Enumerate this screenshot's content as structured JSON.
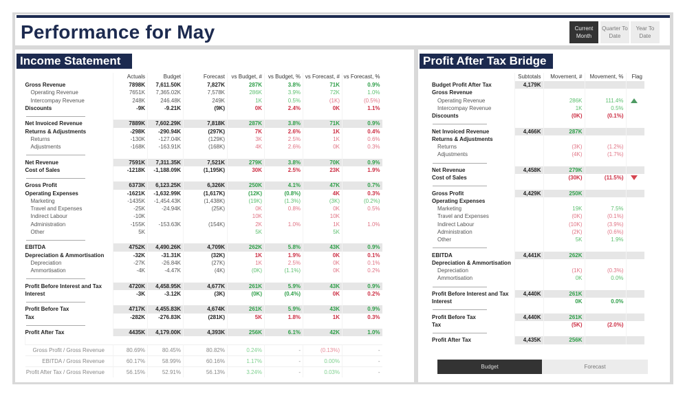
{
  "header": {
    "title": "Performance for May",
    "periods": [
      {
        "label": "Current Month",
        "active": true
      },
      {
        "label": "Quarter To Date",
        "active": false
      },
      {
        "label": "Year To Date",
        "active": false
      }
    ]
  },
  "colors": {
    "navy": "#1c2a4f",
    "positive": "#2e9e48",
    "negative": "#cc2f44"
  },
  "income": {
    "title": "Income Statement",
    "columns": [
      "",
      "Actuals",
      "Budget",
      "Forecast",
      "vs Budget, #",
      "vs Budget, %",
      "vs Forecast, #",
      "vs Forecast, %"
    ],
    "rows": [
      {
        "label": "Gross Revenue",
        "type": "bold",
        "cells": [
          "7898K",
          "7,611.50K",
          "7,827K",
          "287K",
          "3.8%",
          "71K",
          "0.9%"
        ],
        "tones": [
          "",
          "",
          "",
          "g",
          "g",
          "g",
          "g"
        ]
      },
      {
        "label": "Operating Revenue",
        "type": "sub",
        "cells": [
          "7651K",
          "7,365.02K",
          "7,578K",
          "286K",
          "3.9%",
          "72K",
          "1.0%"
        ],
        "tones": [
          "",
          "",
          "",
          "g",
          "g",
          "g",
          "g"
        ]
      },
      {
        "label": "Intercompay Revenue",
        "type": "sub",
        "cells": [
          "248K",
          "246.48K",
          "249K",
          "1K",
          "0.5%",
          "(1K)",
          "(0.5%)"
        ],
        "tones": [
          "",
          "",
          "",
          "g",
          "g",
          "r",
          "r"
        ]
      },
      {
        "label": "Discounts",
        "type": "bold",
        "cells": [
          "-9K",
          "-9.21K",
          "(9K)",
          "0K",
          "2.4%",
          "0K",
          "1.1%"
        ],
        "tones": [
          "",
          "",
          "",
          "r",
          "r",
          "r",
          "r"
        ]
      },
      {
        "type": "sep"
      },
      {
        "label": "Net Invoiced Revenue",
        "type": "total",
        "cells": [
          "7889K",
          "7,602.29K",
          "7,818K",
          "287K",
          "3.8%",
          "71K",
          "0.9%"
        ],
        "tones": [
          "",
          "",
          "",
          "g",
          "g",
          "g",
          "g"
        ]
      },
      {
        "label": "Returns & Adjustments",
        "type": "bold",
        "cells": [
          "-298K",
          "-290.94K",
          "(297K)",
          "7K",
          "2.6%",
          "1K",
          "0.4%"
        ],
        "tones": [
          "",
          "",
          "",
          "r",
          "r",
          "r",
          "r"
        ]
      },
      {
        "label": "Returns",
        "type": "sub",
        "cells": [
          "-130K",
          "-127.04K",
          "(129K)",
          "3K",
          "2.5%",
          "1K",
          "0.6%"
        ],
        "tones": [
          "",
          "",
          "",
          "r",
          "r",
          "r",
          "r"
        ]
      },
      {
        "label": "Adjustments",
        "type": "sub",
        "cells": [
          "-168K",
          "-163.91K",
          "(168K)",
          "4K",
          "2.6%",
          "0K",
          "0.3%"
        ],
        "tones": [
          "",
          "",
          "",
          "r",
          "r",
          "r",
          "r"
        ]
      },
      {
        "type": "sep"
      },
      {
        "label": "Net Revenue",
        "type": "total",
        "cells": [
          "7591K",
          "7,311.35K",
          "7,521K",
          "279K",
          "3.8%",
          "70K",
          "0.9%"
        ],
        "tones": [
          "",
          "",
          "",
          "g",
          "g",
          "g",
          "g"
        ]
      },
      {
        "label": "Cost of Sales",
        "type": "bold",
        "cells": [
          "-1218K",
          "-1,188.09K",
          "(1,195K)",
          "30K",
          "2.5%",
          "23K",
          "1.9%"
        ],
        "tones": [
          "",
          "",
          "",
          "r",
          "r",
          "r",
          "r"
        ]
      },
      {
        "type": "sep"
      },
      {
        "label": "Gross Profit",
        "type": "total",
        "cells": [
          "6373K",
          "6,123.25K",
          "6,326K",
          "250K",
          "4.1%",
          "47K",
          "0.7%"
        ],
        "tones": [
          "",
          "",
          "",
          "g",
          "g",
          "g",
          "g"
        ]
      },
      {
        "label": "Operating Expenses",
        "type": "bold",
        "cells": [
          "-1621K",
          "-1,632.99K",
          "(1,617K)",
          "(12K)",
          "(0.8%)",
          "4K",
          "0.3%"
        ],
        "tones": [
          "",
          "",
          "",
          "g",
          "g",
          "r",
          "r"
        ]
      },
      {
        "label": "Marketing",
        "type": "sub",
        "cells": [
          "-1435K",
          "-1,454.43K",
          "(1,438K)",
          "(19K)",
          "(1.3%)",
          "(3K)",
          "(0.2%)"
        ],
        "tones": [
          "",
          "",
          "",
          "g",
          "g",
          "g",
          "g"
        ]
      },
      {
        "label": "Travel and Expenses",
        "type": "sub",
        "cells": [
          "-25K",
          "-24.94K",
          "(25K)",
          "0K",
          "0.8%",
          "0K",
          "0.5%"
        ],
        "tones": [
          "",
          "",
          "",
          "r",
          "r",
          "r",
          "r"
        ]
      },
      {
        "label": "Indirect Labour",
        "type": "sub",
        "cells": [
          "-10K",
          "",
          "",
          "10K",
          "",
          "10K",
          ""
        ],
        "tones": [
          "",
          "",
          "",
          "r",
          "",
          "r",
          ""
        ]
      },
      {
        "label": "Administration",
        "type": "sub",
        "cells": [
          "-155K",
          "-153.63K",
          "(154K)",
          "2K",
          "1.0%",
          "1K",
          "1.0%"
        ],
        "tones": [
          "",
          "",
          "",
          "r",
          "r",
          "r",
          "r"
        ]
      },
      {
        "label": "Other",
        "type": "sub",
        "cells": [
          "5K",
          "",
          "",
          "5K",
          "",
          "5K",
          ""
        ],
        "tones": [
          "",
          "",
          "",
          "g",
          "",
          "g",
          ""
        ]
      },
      {
        "type": "sep"
      },
      {
        "label": "EBITDA",
        "type": "total",
        "cells": [
          "4752K",
          "4,490.26K",
          "4,709K",
          "262K",
          "5.8%",
          "43K",
          "0.9%"
        ],
        "tones": [
          "",
          "",
          "",
          "g",
          "g",
          "g",
          "g"
        ]
      },
      {
        "label": "Depreciation & Ammortisation",
        "type": "bold",
        "cells": [
          "-32K",
          "-31.31K",
          "(32K)",
          "1K",
          "1.9%",
          "0K",
          "0.1%"
        ],
        "tones": [
          "",
          "",
          "",
          "r",
          "r",
          "r",
          "r"
        ]
      },
      {
        "label": "Depreciation",
        "type": "sub",
        "cells": [
          "-27K",
          "-26.84K",
          "(27K)",
          "1K",
          "2.5%",
          "0K",
          "0.1%"
        ],
        "tones": [
          "",
          "",
          "",
          "r",
          "r",
          "r",
          "r"
        ]
      },
      {
        "label": "Ammortisation",
        "type": "sub",
        "cells": [
          "-4K",
          "-4.47K",
          "(4K)",
          "(0K)",
          "(1.1%)",
          "0K",
          "0.2%"
        ],
        "tones": [
          "",
          "",
          "",
          "g",
          "g",
          "r",
          "r"
        ]
      },
      {
        "type": "sep"
      },
      {
        "label": "Profit Before Interest and Tax",
        "type": "total",
        "cells": [
          "4720K",
          "4,458.95K",
          "4,677K",
          "261K",
          "5.9%",
          "43K",
          "0.9%"
        ],
        "tones": [
          "",
          "",
          "",
          "g",
          "g",
          "g",
          "g"
        ]
      },
      {
        "label": "Interest",
        "type": "bold",
        "cells": [
          "-3K",
          "-3.12K",
          "(3K)",
          "(0K)",
          "(0.4%)",
          "0K",
          "0.2%"
        ],
        "tones": [
          "",
          "",
          "",
          "g",
          "g",
          "r",
          "r"
        ]
      },
      {
        "type": "sep"
      },
      {
        "label": "Profit Before Tax",
        "type": "total",
        "cells": [
          "4717K",
          "4,455.83K",
          "4,674K",
          "261K",
          "5.9%",
          "43K",
          "0.9%"
        ],
        "tones": [
          "",
          "",
          "",
          "g",
          "g",
          "g",
          "g"
        ]
      },
      {
        "label": "Tax",
        "type": "bold",
        "cells": [
          "-282K",
          "-276.83K",
          "(281K)",
          "5K",
          "1.8%",
          "1K",
          "0.3%"
        ],
        "tones": [
          "",
          "",
          "",
          "r",
          "r",
          "r",
          "r"
        ]
      },
      {
        "type": "sep"
      },
      {
        "label": "Profit After Tax",
        "type": "total",
        "cells": [
          "4435K",
          "4,179.00K",
          "4,393K",
          "256K",
          "6.1%",
          "42K",
          "1.0%"
        ],
        "tones": [
          "",
          "",
          "",
          "g",
          "g",
          "g",
          "g"
        ]
      }
    ],
    "ratios": [
      {
        "label": "Gross Profit / Gross Revenue",
        "cells": [
          "80.69%",
          "80.45%",
          "80.82%",
          "0.24%",
          "-",
          "(0.13%)",
          "-"
        ],
        "tones": [
          "",
          "",
          "",
          "g",
          "",
          "r",
          ""
        ]
      },
      {
        "label": "EBITDA / Gross Revenue",
        "cells": [
          "60.17%",
          "58.99%",
          "60.16%",
          "1.17%",
          "-",
          "0.00%",
          "-"
        ],
        "tones": [
          "",
          "",
          "",
          "g",
          "",
          "g",
          ""
        ]
      },
      {
        "label": "Profit After Tax / Gross Revenue",
        "cells": [
          "56.15%",
          "52.91%",
          "56.13%",
          "3.24%",
          "-",
          "0.03%",
          "-"
        ],
        "tones": [
          "",
          "",
          "",
          "g",
          "",
          "g",
          ""
        ]
      }
    ]
  },
  "bridge": {
    "title": "Profit After Tax Bridge",
    "columns": [
      "",
      "Subtotals",
      "Movement, #",
      "Movement, %",
      "Flag"
    ],
    "rows": [
      {
        "label": "Budget Profit After Tax",
        "type": "total",
        "cells": [
          "4,179K",
          "",
          "",
          ""
        ],
        "tones": [
          "",
          "",
          "",
          ""
        ]
      },
      {
        "label": "Gross Revenue",
        "type": "bold",
        "cells": [
          "",
          "",
          "",
          ""
        ],
        "tones": [
          "",
          "",
          "",
          ""
        ]
      },
      {
        "label": "Operating Revenue",
        "type": "sub",
        "cells": [
          "",
          "286K",
          "111.4%",
          ""
        ],
        "tones": [
          "",
          "g",
          "g",
          ""
        ],
        "flag": "up"
      },
      {
        "label": "Intercompay Revenue",
        "type": "sub",
        "cells": [
          "",
          "1K",
          "0.5%",
          ""
        ],
        "tones": [
          "",
          "g",
          "g",
          ""
        ]
      },
      {
        "label": "Discounts",
        "type": "bold",
        "cells": [
          "",
          "(0K)",
          "(0.1%)",
          ""
        ],
        "tones": [
          "",
          "r",
          "r",
          ""
        ]
      },
      {
        "type": "sep"
      },
      {
        "label": "Net Invoiced Revenue",
        "type": "total",
        "cells": [
          "4,466K",
          "287K",
          "",
          ""
        ],
        "tones": [
          "",
          "g",
          "",
          ""
        ]
      },
      {
        "label": "Returns & Adjustments",
        "type": "bold",
        "cells": [
          "",
          "",
          "",
          ""
        ],
        "tones": [
          "",
          "",
          "",
          ""
        ]
      },
      {
        "label": "Returns",
        "type": "sub",
        "cells": [
          "",
          "(3K)",
          "(1.2%)",
          ""
        ],
        "tones": [
          "",
          "r",
          "r",
          ""
        ]
      },
      {
        "label": "Adjustments",
        "type": "sub",
        "cells": [
          "",
          "(4K)",
          "(1.7%)",
          ""
        ],
        "tones": [
          "",
          "r",
          "r",
          ""
        ]
      },
      {
        "type": "sep"
      },
      {
        "label": "Net Revenue",
        "type": "total",
        "cells": [
          "4,458K",
          "279K",
          "",
          ""
        ],
        "tones": [
          "",
          "g",
          "",
          ""
        ]
      },
      {
        "label": "Cost of Sales",
        "type": "bold",
        "cells": [
          "",
          "(30K)",
          "(11.5%)",
          ""
        ],
        "tones": [
          "",
          "r",
          "r",
          ""
        ],
        "flag": "down"
      },
      {
        "type": "sep"
      },
      {
        "label": "Gross Profit",
        "type": "total",
        "cells": [
          "4,429K",
          "250K",
          "",
          ""
        ],
        "tones": [
          "",
          "g",
          "",
          ""
        ]
      },
      {
        "label": "Operating Expenses",
        "type": "bold",
        "cells": [
          "",
          "",
          "",
          ""
        ],
        "tones": [
          "",
          "",
          "",
          ""
        ]
      },
      {
        "label": "Marketing",
        "type": "sub",
        "cells": [
          "",
          "19K",
          "7.5%",
          ""
        ],
        "tones": [
          "",
          "g",
          "g",
          ""
        ]
      },
      {
        "label": "Travel and Expenses",
        "type": "sub",
        "cells": [
          "",
          "(0K)",
          "(0.1%)",
          ""
        ],
        "tones": [
          "",
          "r",
          "r",
          ""
        ]
      },
      {
        "label": "Indirect Labour",
        "type": "sub",
        "cells": [
          "",
          "(10K)",
          "(3.9%)",
          ""
        ],
        "tones": [
          "",
          "r",
          "r",
          ""
        ]
      },
      {
        "label": "Administration",
        "type": "sub",
        "cells": [
          "",
          "(2K)",
          "(0.6%)",
          ""
        ],
        "tones": [
          "",
          "r",
          "r",
          ""
        ]
      },
      {
        "label": "Other",
        "type": "sub",
        "cells": [
          "",
          "5K",
          "1.9%",
          ""
        ],
        "tones": [
          "",
          "g",
          "g",
          ""
        ]
      },
      {
        "type": "sep"
      },
      {
        "label": "EBITDA",
        "type": "total",
        "cells": [
          "4,441K",
          "262K",
          "",
          ""
        ],
        "tones": [
          "",
          "g",
          "",
          ""
        ]
      },
      {
        "label": "Depreciation & Ammortisation",
        "type": "bold",
        "cells": [
          "",
          "",
          "",
          ""
        ],
        "tones": [
          "",
          "",
          "",
          ""
        ]
      },
      {
        "label": "Depreciation",
        "type": "sub",
        "cells": [
          "",
          "(1K)",
          "(0.3%)",
          ""
        ],
        "tones": [
          "",
          "r",
          "r",
          ""
        ]
      },
      {
        "label": "Ammortisation",
        "type": "sub",
        "cells": [
          "",
          "0K",
          "0.0%",
          ""
        ],
        "tones": [
          "",
          "g",
          "g",
          ""
        ]
      },
      {
        "type": "sep"
      },
      {
        "label": "Profit Before Interest and Tax",
        "type": "total",
        "cells": [
          "4,440K",
          "261K",
          "",
          ""
        ],
        "tones": [
          "",
          "g",
          "",
          ""
        ]
      },
      {
        "label": "Interest",
        "type": "bold",
        "cells": [
          "",
          "0K",
          "0.0%",
          ""
        ],
        "tones": [
          "",
          "g",
          "g",
          ""
        ]
      },
      {
        "type": "sep"
      },
      {
        "label": "Profit Before Tax",
        "type": "total",
        "cells": [
          "4,440K",
          "261K",
          "",
          ""
        ],
        "tones": [
          "",
          "g",
          "",
          ""
        ]
      },
      {
        "label": "Tax",
        "type": "bold",
        "cells": [
          "",
          "(5K)",
          "(2.0%)",
          ""
        ],
        "tones": [
          "",
          "r",
          "r",
          ""
        ]
      },
      {
        "type": "sep"
      },
      {
        "label": "Profit After Tax",
        "type": "total",
        "cells": [
          "4,435K",
          "256K",
          "",
          ""
        ],
        "tones": [
          "",
          "g",
          "",
          ""
        ]
      }
    ],
    "scenario": [
      {
        "label": "Budget",
        "active": true
      },
      {
        "label": "Forecast",
        "active": false
      }
    ]
  }
}
